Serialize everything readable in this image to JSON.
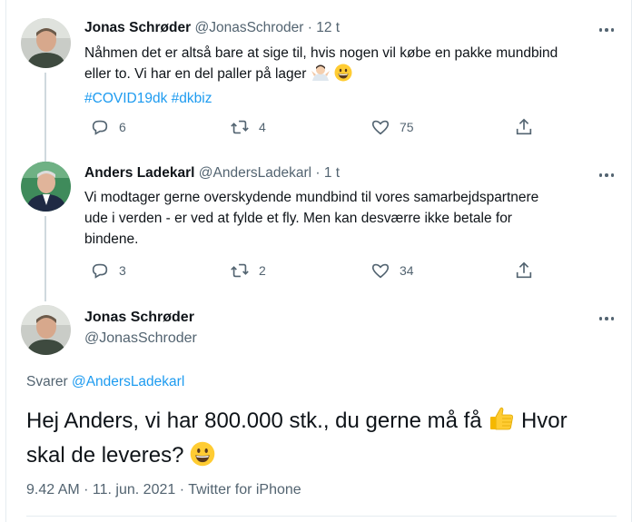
{
  "tweets": [
    {
      "name": "Jonas Schrøder",
      "handle": "@JonasSchroder",
      "time": "· 12 t",
      "text_line1": "Nåhmen det er altså bare at sige til, hvis nogen vil købe en pakke mundbind",
      "text_line2": "eller to. Vi har en del paller på lager",
      "hashtag1": "#COVID19dk",
      "hashtag2": "#dkbiz",
      "replies": "6",
      "retweets": "4",
      "likes": "75"
    },
    {
      "name": "Anders Ladekarl",
      "handle": "@AndersLadekarl",
      "time": "· 1 t",
      "text_line1": "Vi modtager gerne overskydende mundbind til vores samarbejdspartnere",
      "text_line2": "ude i verden - er ved at fylde et fly. Men kan desværre ikke betale for",
      "text_line3": "bindene.",
      "replies": "3",
      "retweets": "2",
      "likes": "34"
    }
  ],
  "main_tweet": {
    "name": "Jonas Schrøder",
    "handle": "@JonasSchroder",
    "replying_label": "Svarer",
    "replying_to": "@AndersLadekarl",
    "text_line1": "Hej Anders, vi har 800.000 stk., du gerne må få",
    "text_line1_end": "Hvor",
    "text_line2": "skal de leveres?",
    "meta": "9.42 AM · 11. jun. 2021 · Twitter for iPhone"
  },
  "colors": {
    "accent": "#1d9bf0",
    "secondary_text": "#536471",
    "thread_line": "#cfd9de"
  },
  "icons": [
    "more-icon",
    "reply-icon",
    "retweet-icon",
    "like-icon",
    "share-icon",
    "man-shrugging-emoji",
    "grinning-face-emoji",
    "thumbs-up-emoji"
  ]
}
